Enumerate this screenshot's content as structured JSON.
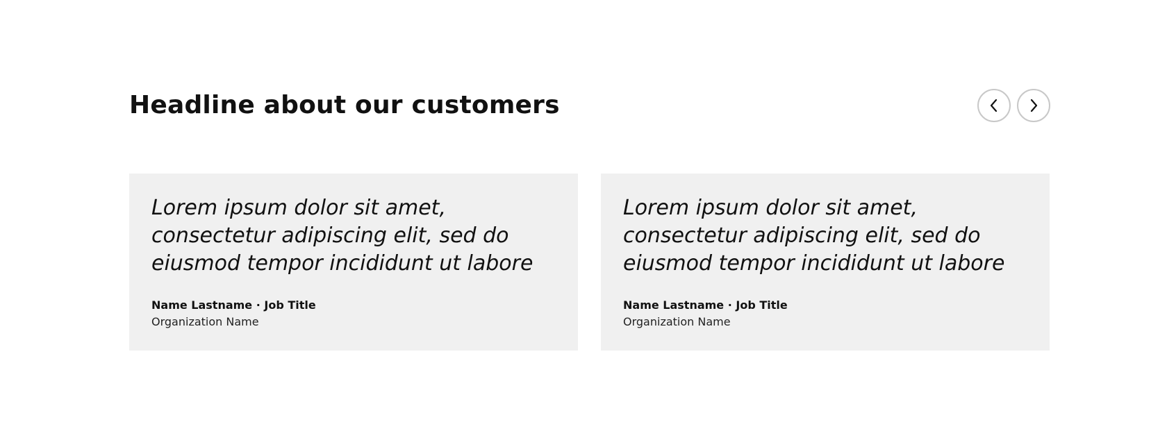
{
  "section": {
    "headline": "Headline about our customers"
  },
  "nav": {
    "prev_icon": "chevron-left-icon",
    "next_icon": "chevron-right-icon"
  },
  "testimonials": [
    {
      "quote": "Lorem ipsum dolor sit amet, consectetur adipiscing elit, sed do eiusmod tempor incididunt ut labore",
      "author": "Name Lastname · Job Title",
      "organization": "Organization Name"
    },
    {
      "quote": "Lorem ipsum dolor sit amet, consectetur adipiscing elit, sed do eiusmod tempor incididunt ut labore",
      "author": "Name Lastname · Job Title",
      "organization": "Organization Name"
    }
  ],
  "colors": {
    "card_background": "#f0f0f0",
    "nav_border": "#c8c8c8",
    "text": "#111111"
  }
}
